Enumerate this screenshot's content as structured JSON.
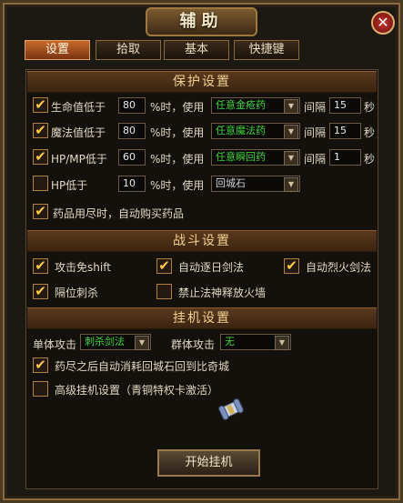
{
  "window": {
    "title": "辅助"
  },
  "tabs": [
    {
      "label": "设置"
    },
    {
      "label": "拾取"
    },
    {
      "label": "基本"
    },
    {
      "label": "快捷键"
    }
  ],
  "protect": {
    "header": "保护设置",
    "rows": [
      {
        "label": "生命值低于",
        "value": "80",
        "mid": "%时，使用",
        "item": "任意金疮药",
        "interval_label": "间隔",
        "interval": "15",
        "unit": "秒",
        "checked": true,
        "item_color": "#3cd23c"
      },
      {
        "label": "魔法值低于",
        "value": "80",
        "mid": "%时，使用",
        "item": "任意魔法药",
        "interval_label": "间隔",
        "interval": "15",
        "unit": "秒",
        "checked": true,
        "item_color": "#3cd23c"
      },
      {
        "label": "HP/MP低于",
        "value": "60",
        "mid": "%时，使用",
        "item": "任意瞬回药",
        "interval_label": "间隔",
        "interval": "1",
        "unit": "秒",
        "checked": true,
        "item_color": "#3cd23c"
      },
      {
        "label": "HP低于",
        "value": "10",
        "mid": "%时，使用",
        "item": "回城石",
        "checked": false,
        "item_color": "#cfcfcf"
      }
    ],
    "auto_buy": "药品用尽时，自动购买药品"
  },
  "combat": {
    "header": "战斗设置",
    "opts": [
      {
        "label": "攻击免shift",
        "checked": true
      },
      {
        "label": "自动逐日剑法",
        "checked": true
      },
      {
        "label": "自动烈火剑法",
        "checked": true
      },
      {
        "label": "隔位刺杀",
        "checked": true
      },
      {
        "label": "禁止法神释放火墙",
        "checked": false
      }
    ]
  },
  "hangup": {
    "header": "挂机设置",
    "single_label": "单体攻击",
    "single_value": "刺杀剑法",
    "group_label": "群体攻击",
    "group_value": "无",
    "return_city": "药尽之后自动消耗回城石回到比奇城",
    "return_city_checked": true,
    "advanced": "高级挂机设置（青铜特权卡激活）",
    "advanced_checked": false,
    "start_button": "开始挂机"
  },
  "icons": {
    "close": "close-icon",
    "check": "checkmark-icon",
    "arrow": "dropdown-arrow-icon",
    "scroll": "scroll-icon"
  }
}
